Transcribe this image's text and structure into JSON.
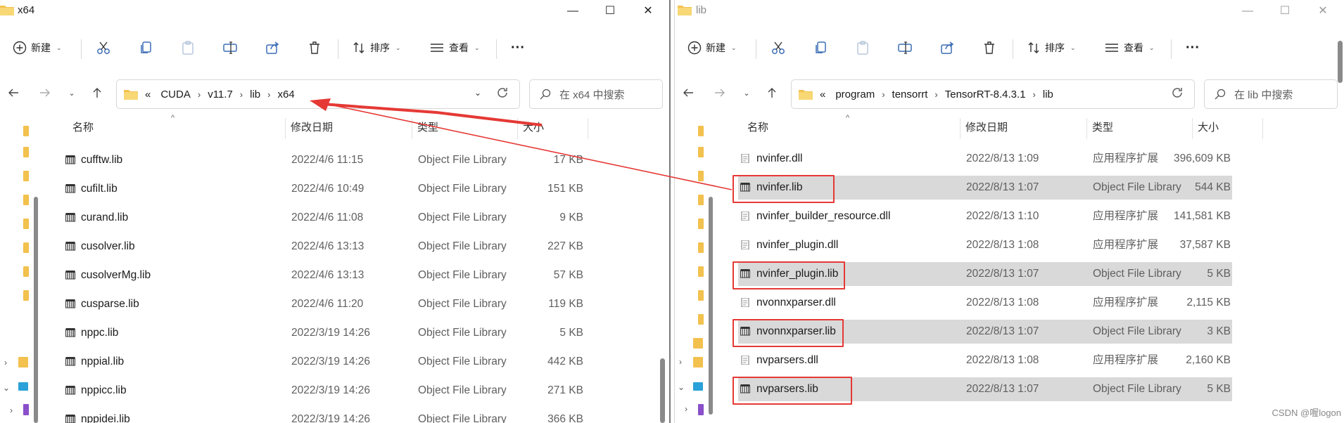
{
  "left": {
    "title": "x64",
    "toolbar": {
      "new": "新建",
      "sort": "排序",
      "view": "查看",
      "more": "···"
    },
    "address": {
      "prefix": "«",
      "crumbs": [
        "CUDA",
        "v11.7",
        "lib",
        "x64"
      ]
    },
    "search_placeholder": "在 x64 中搜索",
    "columns": {
      "name": "名称",
      "date": "修改日期",
      "type": "类型",
      "size": "大小"
    },
    "rows": [
      {
        "name": "cufftw.lib",
        "date": "2022/4/6 11:15",
        "type": "Object File Library",
        "size": "17 KB"
      },
      {
        "name": "cufilt.lib",
        "date": "2022/4/6 10:49",
        "type": "Object File Library",
        "size": "151 KB"
      },
      {
        "name": "curand.lib",
        "date": "2022/4/6 11:08",
        "type": "Object File Library",
        "size": "9 KB"
      },
      {
        "name": "cusolver.lib",
        "date": "2022/4/6 13:13",
        "type": "Object File Library",
        "size": "227 KB"
      },
      {
        "name": "cusolverMg.lib",
        "date": "2022/4/6 13:13",
        "type": "Object File Library",
        "size": "57 KB"
      },
      {
        "name": "cusparse.lib",
        "date": "2022/4/6 11:20",
        "type": "Object File Library",
        "size": "119 KB"
      },
      {
        "name": "nppc.lib",
        "date": "2022/3/19 14:26",
        "type": "Object File Library",
        "size": "5 KB"
      },
      {
        "name": "nppial.lib",
        "date": "2022/3/19 14:26",
        "type": "Object File Library",
        "size": "442 KB"
      },
      {
        "name": "nppicc.lib",
        "date": "2022/3/19 14:26",
        "type": "Object File Library",
        "size": "271 KB"
      },
      {
        "name": "nppidei.lib",
        "date": "2022/3/19 14:26",
        "type": "Object File Library",
        "size": "366 KB"
      }
    ]
  },
  "right": {
    "title": "lib",
    "toolbar": {
      "new": "新建",
      "sort": "排序",
      "view": "查看",
      "more": "···"
    },
    "address": {
      "prefix": "«",
      "crumbs": [
        "program",
        "tensorrt",
        "TensorRT-8.4.3.1",
        "lib"
      ]
    },
    "search_placeholder": "在 lib 中搜索",
    "columns": {
      "name": "名称",
      "date": "修改日期",
      "type": "类型",
      "size": "大小"
    },
    "rows": [
      {
        "name": "nvinfer.dll",
        "date": "2022/8/13 1:09",
        "type": "应用程序扩展",
        "size": "396,609 KB",
        "kind": "dll",
        "selected": false,
        "boxed": false
      },
      {
        "name": "nvinfer.lib",
        "date": "2022/8/13 1:07",
        "type": "Object File Library",
        "size": "544 KB",
        "kind": "lib",
        "selected": true,
        "boxed": true
      },
      {
        "name": "nvinfer_builder_resource.dll",
        "date": "2022/8/13 1:10",
        "type": "应用程序扩展",
        "size": "141,581 KB",
        "kind": "dll",
        "selected": false,
        "boxed": false
      },
      {
        "name": "nvinfer_plugin.dll",
        "date": "2022/8/13 1:08",
        "type": "应用程序扩展",
        "size": "37,587 KB",
        "kind": "dll",
        "selected": false,
        "boxed": false
      },
      {
        "name": "nvinfer_plugin.lib",
        "date": "2022/8/13 1:07",
        "type": "Object File Library",
        "size": "5 KB",
        "kind": "lib",
        "selected": true,
        "boxed": true
      },
      {
        "name": "nvonnxparser.dll",
        "date": "2022/8/13 1:08",
        "type": "应用程序扩展",
        "size": "2,115 KB",
        "kind": "dll",
        "selected": false,
        "boxed": false
      },
      {
        "name": "nvonnxparser.lib",
        "date": "2022/8/13 1:07",
        "type": "Object File Library",
        "size": "3 KB",
        "kind": "lib",
        "selected": true,
        "boxed": true
      },
      {
        "name": "nvparsers.dll",
        "date": "2022/8/13 1:08",
        "type": "应用程序扩展",
        "size": "2,160 KB",
        "kind": "dll",
        "selected": false,
        "boxed": false
      },
      {
        "name": "nvparsers.lib",
        "date": "2022/8/13 1:07",
        "type": "Object File Library",
        "size": "5 KB",
        "kind": "lib",
        "selected": true,
        "boxed": true
      }
    ]
  },
  "watermark": "CSDN @喔logon",
  "colors": {
    "annotation": "#e53935",
    "folder": "#f2c14e",
    "selection": "#d9d9d9"
  }
}
